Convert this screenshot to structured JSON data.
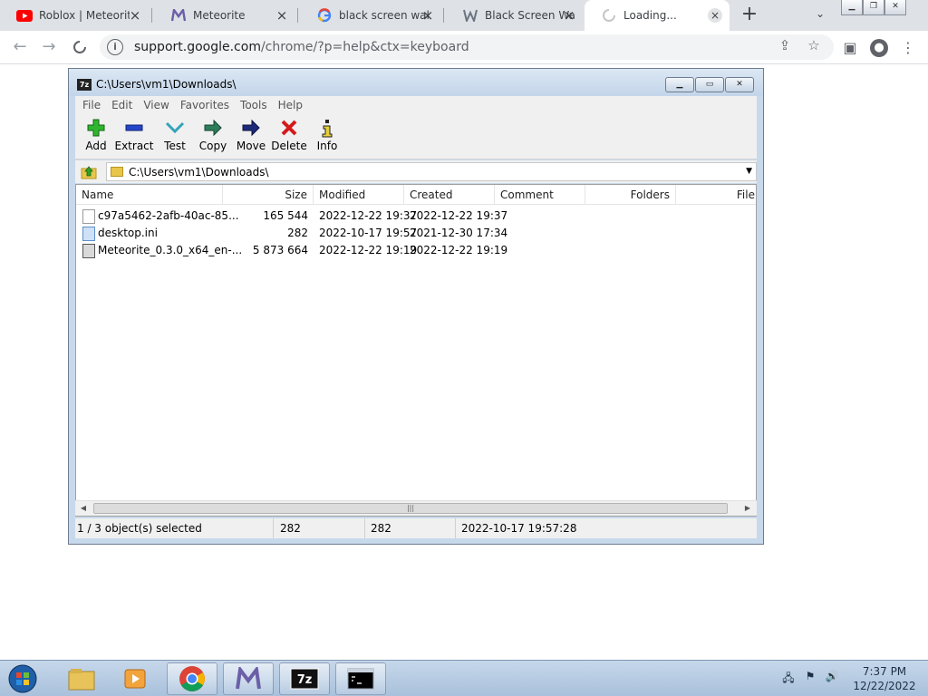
{
  "browser": {
    "tabs": [
      {
        "title": "Roblox | Meteorit",
        "icon": "youtube-icon"
      },
      {
        "title": "Meteorite",
        "icon": "meteorite-icon"
      },
      {
        "title": "black screen wallp",
        "icon": "google-icon"
      },
      {
        "title": "Black Screen Wall",
        "icon": "wallpaper-site-icon"
      },
      {
        "title": "Loading...",
        "icon": "loading-spinner-icon"
      }
    ],
    "url_host": "support.google.com",
    "url_path": "/chrome/?p=help&ctx=keyboard"
  },
  "zip": {
    "title": "C:\\Users\\vm1\\Downloads\\",
    "menu": [
      "File",
      "Edit",
      "View",
      "Favorites",
      "Tools",
      "Help"
    ],
    "tools": [
      "Add",
      "Extract",
      "Test",
      "Copy",
      "Move",
      "Delete",
      "Info"
    ],
    "path": "C:\\Users\\vm1\\Downloads\\",
    "columns": [
      "Name",
      "Size",
      "Modified",
      "Created",
      "Comment",
      "Folders",
      "File"
    ],
    "rows": [
      {
        "name": "c97a5462-2afb-40ac-85...",
        "size": "165 544",
        "modified": "2022-12-22 19:37",
        "created": "2022-12-22 19:37",
        "type": "file"
      },
      {
        "name": "desktop.ini",
        "size": "282",
        "modified": "2022-10-17 19:57",
        "created": "2021-12-30 17:34",
        "type": "ini"
      },
      {
        "name": "Meteorite_0.3.0_x64_en-...",
        "size": "5 873 664",
        "modified": "2022-12-22 19:19",
        "created": "2022-12-22 19:19",
        "type": "exe"
      }
    ],
    "status": {
      "selection": "1 / 3 object(s) selected",
      "size": "282",
      "packed": "282",
      "date": "2022-10-17 19:57:28"
    }
  },
  "taskbar": {
    "time": "7:37 PM",
    "date": "12/22/2022"
  }
}
